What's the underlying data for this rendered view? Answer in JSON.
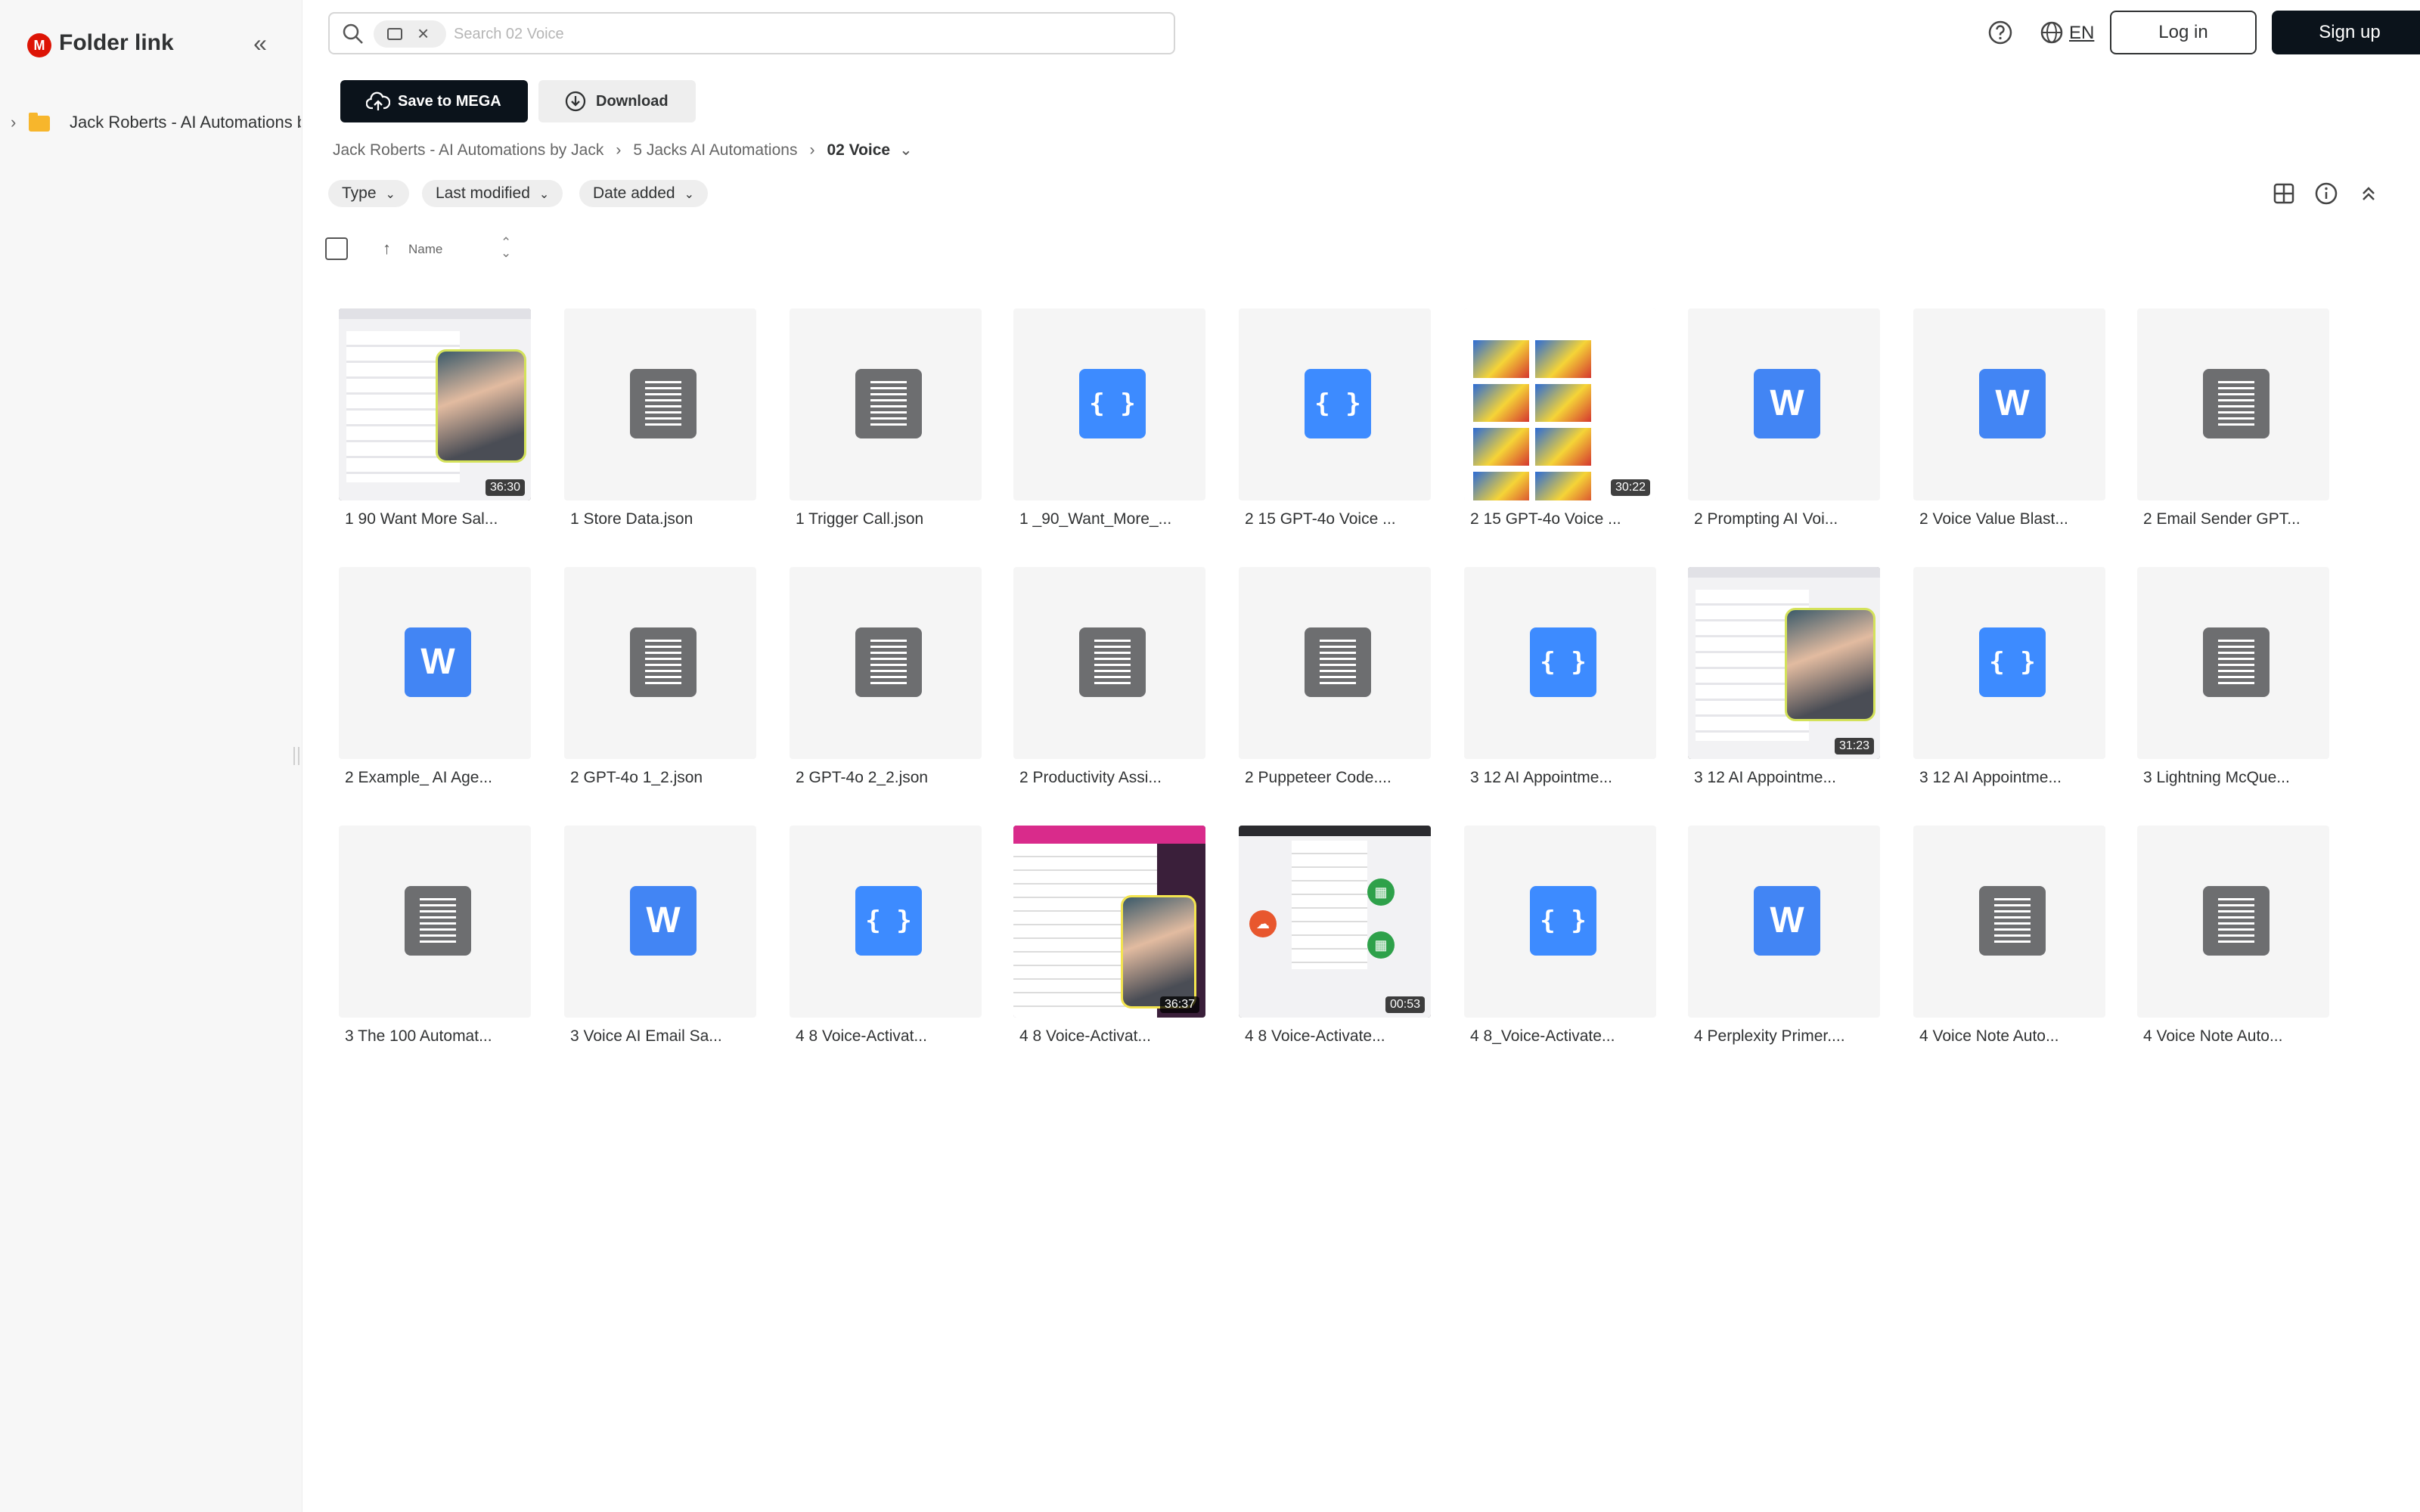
{
  "app": {
    "brand": "Folder link",
    "logo_letter": "M",
    "accent": "#dd1405"
  },
  "sidebar": {
    "tree": [
      {
        "label": "Jack Roberts - AI Automations by Jack"
      }
    ]
  },
  "search": {
    "placeholder": "Search 02 Voice",
    "value": ""
  },
  "header": {
    "lang": "EN",
    "login": "Log in",
    "signup": "Sign up"
  },
  "toolbar": {
    "save": "Save to MEGA",
    "download": "Download"
  },
  "breadcrumb": {
    "items": [
      "Jack Roberts - AI Automations by Jack",
      "5 Jacks AI Automations",
      "02 Voice"
    ]
  },
  "filters": [
    "Type",
    "Last modified",
    "Date added"
  ],
  "list_header": {
    "name": "Name"
  },
  "files": [
    {
      "name": "1 90 Want More Sal...",
      "kind": "video",
      "duration": "36:30"
    },
    {
      "name": "1 Store Data.json",
      "kind": "text"
    },
    {
      "name": "1 Trigger Call.json",
      "kind": "text"
    },
    {
      "name": "1 _90_Want_More_...",
      "kind": "json"
    },
    {
      "name": "2 15 GPT-4o Voice ...",
      "kind": "json"
    },
    {
      "name": "2 15 GPT-4o Voice ...",
      "kind": "video-grid",
      "duration": "30:22"
    },
    {
      "name": "2 Prompting AI Voi...",
      "kind": "word"
    },
    {
      "name": "2 Voice Value Blast...",
      "kind": "word"
    },
    {
      "name": "2 Email Sender GPT...",
      "kind": "text"
    },
    {
      "name": "2 Example_ AI Age...",
      "kind": "word"
    },
    {
      "name": "2 GPT-4o 1_2.json",
      "kind": "text"
    },
    {
      "name": "2 GPT-4o 2_2.json",
      "kind": "text"
    },
    {
      "name": "2 Productivity Assi...",
      "kind": "text"
    },
    {
      "name": "2 Puppeteer Code....",
      "kind": "text"
    },
    {
      "name": "3 12 AI Appointme...",
      "kind": "json"
    },
    {
      "name": "3 12 AI Appointme...",
      "kind": "video",
      "duration": "31:23"
    },
    {
      "name": "3 12 AI Appointme...",
      "kind": "json"
    },
    {
      "name": "3 Lightning McQue...",
      "kind": "text"
    },
    {
      "name": "3 The 100 Automat...",
      "kind": "text"
    },
    {
      "name": "3 Voice AI Email Sa...",
      "kind": "word"
    },
    {
      "name": "4 8 Voice-Activat...",
      "kind": "json"
    },
    {
      "name": "4 8 Voice-Activat...",
      "kind": "video-sheet",
      "duration": "36:37"
    },
    {
      "name": "4 8 Voice-Activate...",
      "kind": "video-diagram",
      "duration": "00:53"
    },
    {
      "name": "4 8_Voice-Activate...",
      "kind": "json"
    },
    {
      "name": "4 Perplexity Primer....",
      "kind": "word"
    },
    {
      "name": "4 Voice Note Auto...",
      "kind": "text"
    },
    {
      "name": "4 Voice Note Auto...",
      "kind": "text"
    }
  ]
}
